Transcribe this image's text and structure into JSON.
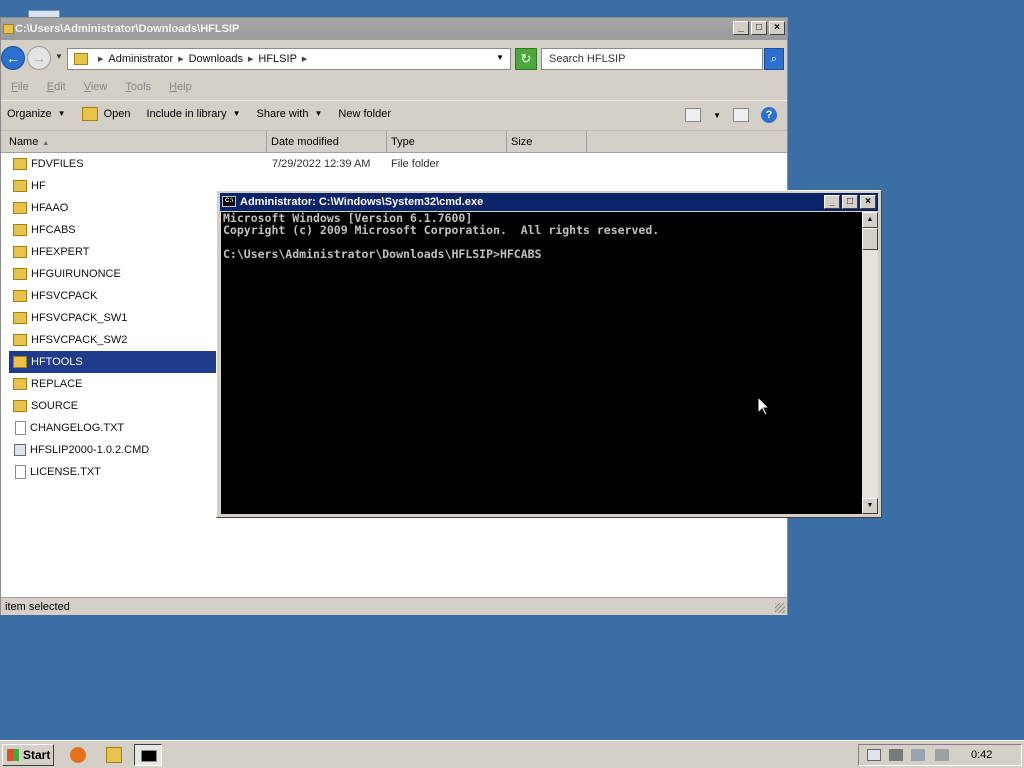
{
  "explorer": {
    "title": "C:\\Users\\Administrator\\Downloads\\HFLSIP",
    "breadcrumbs": [
      "Administrator",
      "Downloads",
      "HFLSIP"
    ],
    "search_placeholder": "Search HFLSIP",
    "menu": [
      "File",
      "Edit",
      "View",
      "Tools",
      "Help"
    ],
    "commands": {
      "organize": "Organize",
      "open": "Open",
      "include": "Include in library",
      "share": "Share with",
      "new_folder": "New folder"
    },
    "columns": {
      "name": "Name",
      "date": "Date modified",
      "type": "Type",
      "size": "Size"
    },
    "files": [
      {
        "name": "FDVFILES",
        "date": "7/29/2022 12:39 AM",
        "type": "File folder",
        "kind": "folder"
      },
      {
        "name": "HF",
        "kind": "folder"
      },
      {
        "name": "HFAAO",
        "kind": "folder"
      },
      {
        "name": "HFCABS",
        "kind": "folder"
      },
      {
        "name": "HFEXPERT",
        "kind": "folder"
      },
      {
        "name": "HFGUIRUNONCE",
        "kind": "folder"
      },
      {
        "name": "HFSVCPACK",
        "kind": "folder"
      },
      {
        "name": "HFSVCPACK_SW1",
        "kind": "folder"
      },
      {
        "name": "HFSVCPACK_SW2",
        "kind": "folder"
      },
      {
        "name": "HFTOOLS",
        "kind": "folder",
        "selected": true
      },
      {
        "name": "REPLACE",
        "kind": "folder"
      },
      {
        "name": "SOURCE",
        "kind": "folder"
      },
      {
        "name": "CHANGELOG.TXT",
        "kind": "text"
      },
      {
        "name": "HFSLIP2000-1.0.2.CMD",
        "kind": "cmd"
      },
      {
        "name": "LICENSE.TXT",
        "kind": "text"
      }
    ],
    "status": "item selected"
  },
  "cmd": {
    "title": "Administrator: C:\\Windows\\System32\\cmd.exe",
    "lines": [
      "Microsoft Windows [Version 6.1.7600]",
      "Copyright (c) 2009 Microsoft Corporation.  All rights reserved.",
      "",
      "C:\\Users\\Administrator\\Downloads\\HFLSIP>HFCABS"
    ]
  },
  "taskbar": {
    "start_label": "Start",
    "clock": "0:42"
  },
  "colors": {
    "desktop": "#3a6ea5",
    "selection": "#1f3c8c",
    "cmd_title": "#0a246a"
  },
  "icons": [
    "folder-icon",
    "search-icon",
    "refresh-icon",
    "help-icon",
    "firefox-icon",
    "explorer-icon",
    "console-icon"
  ]
}
